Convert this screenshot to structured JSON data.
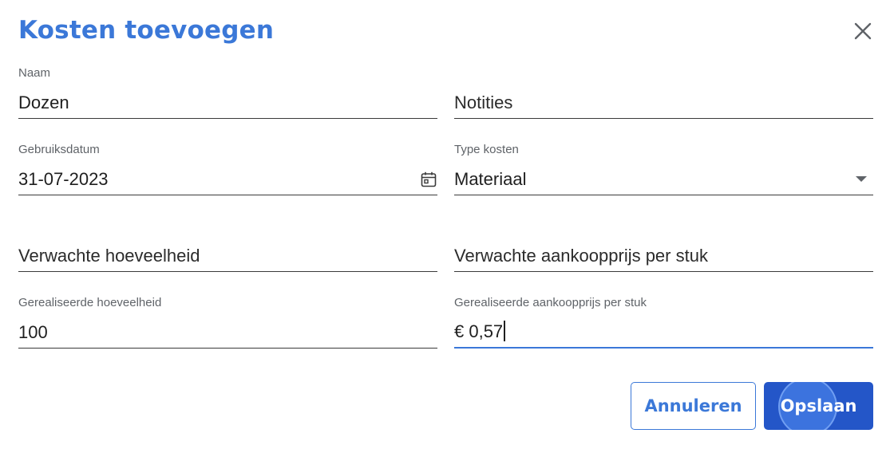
{
  "dialog": {
    "title": "Kosten toevoegen"
  },
  "fields": {
    "naam": {
      "label": "Naam",
      "value": "Dozen"
    },
    "notities": {
      "placeholder": "Notities"
    },
    "gebruiksdatum": {
      "label": "Gebruiksdatum",
      "value": "31-07-2023"
    },
    "type_kosten": {
      "label": "Type kosten",
      "value": "Materiaal"
    },
    "verwachte_hoeveelheid": {
      "placeholder": "Verwachte hoeveelheid"
    },
    "verwachte_prijs": {
      "placeholder": "Verwachte aankoopprijs per stuk"
    },
    "gerealiseerde_hoeveelheid": {
      "label": "Gerealiseerde hoeveelheid",
      "value": "100"
    },
    "gerealiseerde_prijs": {
      "label": "Gerealiseerde aankoopprijs per stuk",
      "value": "€ 0,57"
    }
  },
  "buttons": {
    "cancel": "Annuleren",
    "save": "Opslaan"
  },
  "colors": {
    "accent": "#3b78d8",
    "primary_button": "#2456c8"
  },
  "icons": {
    "close": "close-icon",
    "calendar": "calendar-icon",
    "dropdown": "dropdown-arrow-icon"
  }
}
